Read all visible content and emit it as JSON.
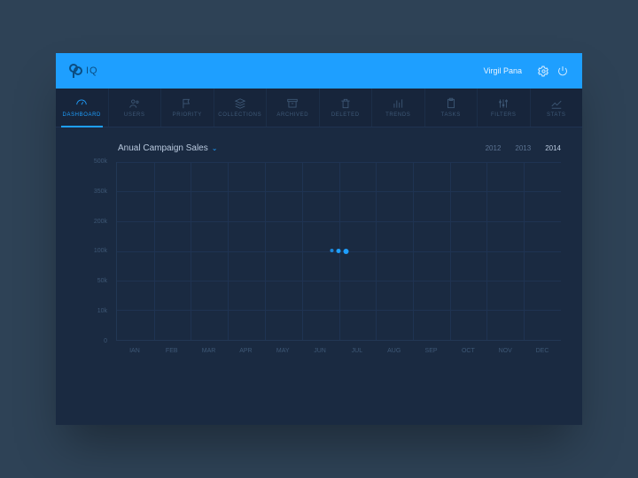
{
  "brand": {
    "name": "IQ"
  },
  "user": {
    "name": "Virgil Pana"
  },
  "nav": {
    "active": 0,
    "items": [
      {
        "label": "DASHBOARD"
      },
      {
        "label": "USERS"
      },
      {
        "label": "PRIORITY"
      },
      {
        "label": "COLLECTIONS"
      },
      {
        "label": "ARCHIVED"
      },
      {
        "label": "DELETED"
      },
      {
        "label": "TRENDS"
      },
      {
        "label": "TASKS"
      },
      {
        "label": "FILTERS"
      },
      {
        "label": "STATS"
      }
    ]
  },
  "chart_data": {
    "type": "line",
    "title": "Anual Campaign Sales",
    "years": [
      "2012",
      "2013",
      "2014"
    ],
    "active_year": "2014",
    "xlabel": "",
    "ylabel": "",
    "ylim": [
      0,
      500000
    ],
    "y_ticks": [
      "500k",
      "350k",
      "200k",
      "100k",
      "50k",
      "10k",
      "0"
    ],
    "categories": [
      "IAN",
      "FEB",
      "MAR",
      "APR",
      "MAY",
      "JUN",
      "JUL",
      "AUG",
      "SEP",
      "OCT",
      "NOV",
      "DEC"
    ],
    "series": [
      {
        "name": "2014",
        "values": [
          null,
          null,
          null,
          null,
          null,
          null,
          null,
          null,
          null,
          null,
          null,
          null
        ]
      }
    ],
    "loading": true
  },
  "colors": {
    "accent": "#1e9fff",
    "panel": "#1a2a41",
    "nav": "#17253b"
  }
}
